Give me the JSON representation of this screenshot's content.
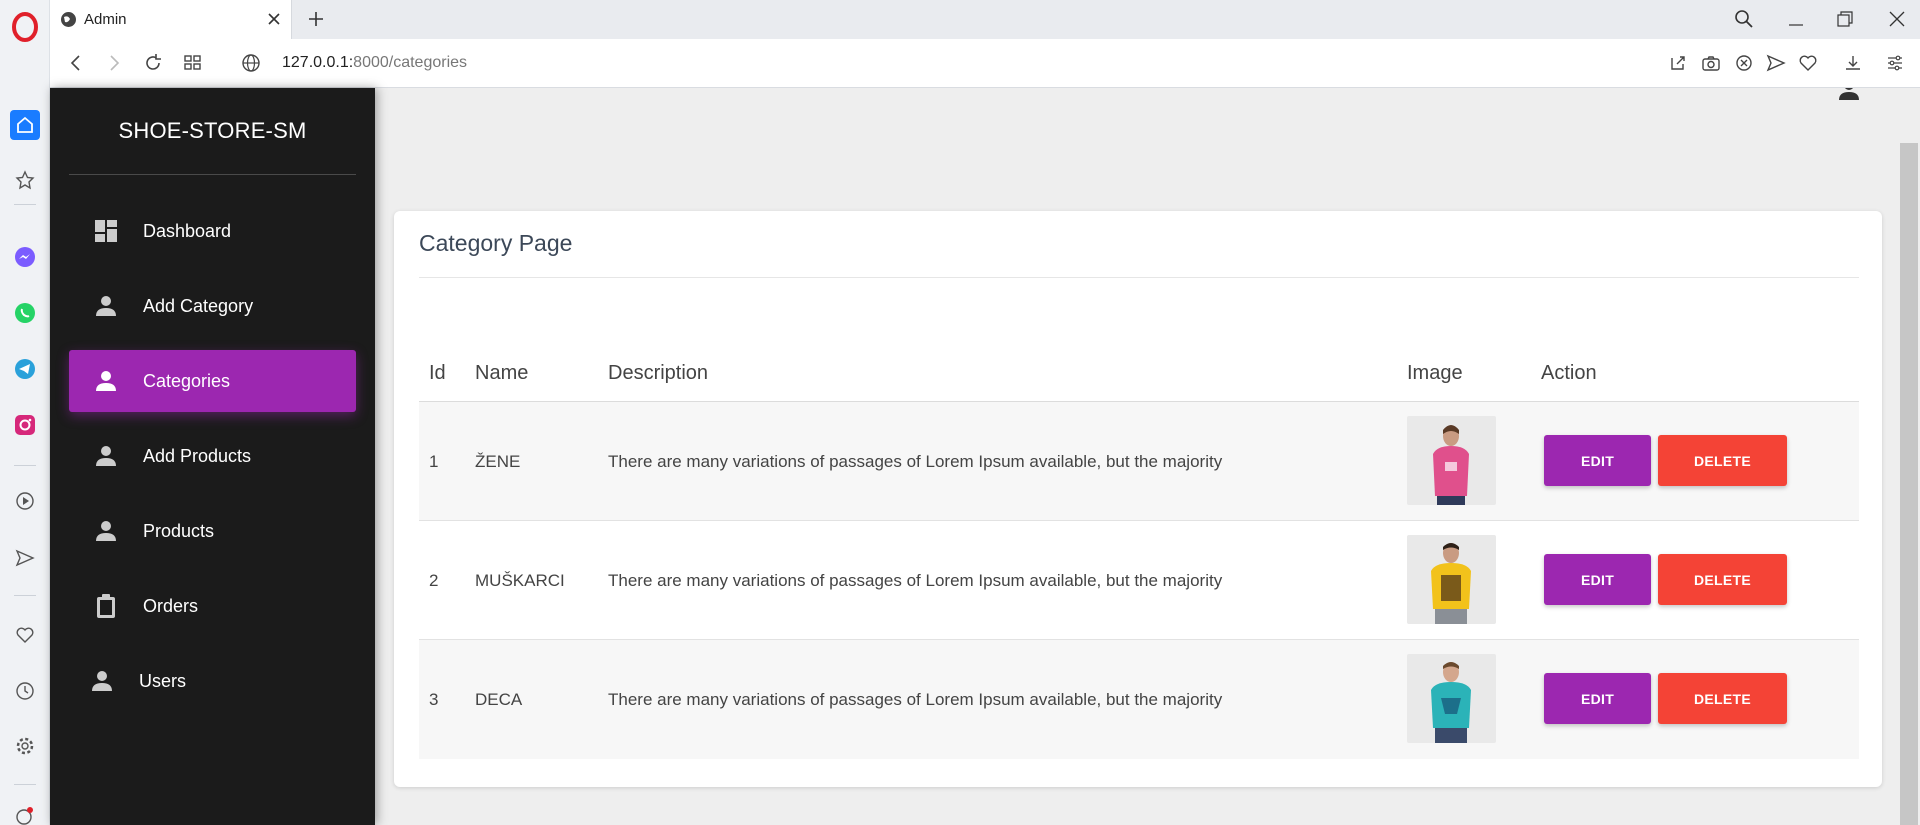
{
  "browser": {
    "tab_title": "Admin",
    "url_host": "127.0.0.1:",
    "url_rest": "8000/categories"
  },
  "sidebar": {
    "brand": "SHOE-STORE-SM",
    "items": [
      {
        "label": "Dashboard",
        "icon": "dashboard-icon",
        "active": false
      },
      {
        "label": "Add Category",
        "icon": "person-icon",
        "active": false
      },
      {
        "label": "Categories",
        "icon": "person-icon",
        "active": true
      },
      {
        "label": "Add Products",
        "icon": "person-icon",
        "active": false
      },
      {
        "label": "Products",
        "icon": "person-icon",
        "active": false
      },
      {
        "label": "Orders",
        "icon": "clipboard-icon",
        "active": false
      },
      {
        "label": "Users",
        "icon": "person-icon",
        "active": false
      }
    ]
  },
  "page": {
    "title": "Category Page"
  },
  "table": {
    "headers": [
      "Id",
      "Name",
      "Description",
      "Image",
      "Action"
    ],
    "rows": [
      {
        "id": "1",
        "name": "ŽENE",
        "description": "There are many variations of passages of Lorem Ipsum available, but the majority",
        "image": "pink-tshirt-model",
        "edit": "EDIT",
        "delete": "DELETE"
      },
      {
        "id": "2",
        "name": "MUŠKARCI",
        "description": "There are many variations of passages of Lorem Ipsum available, but the majority",
        "image": "yellow-tshirt-model",
        "edit": "EDIT",
        "delete": "DELETE"
      },
      {
        "id": "3",
        "name": "DECA",
        "description": "There are many variations of passages of Lorem Ipsum available, but the majority",
        "image": "teal-tshirt-model",
        "edit": "EDIT",
        "delete": "DELETE"
      }
    ]
  },
  "colors": {
    "primary": "#9c27b0",
    "danger": "#f44336",
    "sidebar_bg": "#1b1b1b"
  }
}
